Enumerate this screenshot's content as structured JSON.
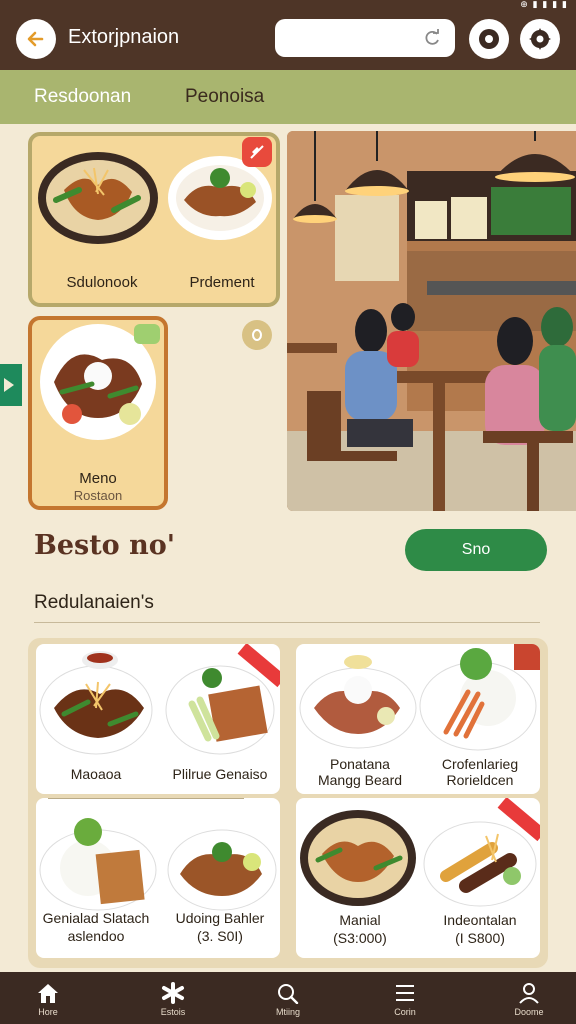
{
  "status_bar": {
    "icons": "⊕ ▮ ▮ ▮ ▮"
  },
  "header": {
    "title": "Extorjpnaion",
    "search": {
      "value": "",
      "placeholder": ""
    }
  },
  "subnav": {
    "tabs": [
      "Resdoonan",
      "Peonoisa"
    ]
  },
  "featured": {
    "card1": {
      "dishes": [
        "Sdulonook",
        "Prdement"
      ]
    },
    "card2": {
      "name": "Meno",
      "price": "Rostaon"
    }
  },
  "section": {
    "title": "Besto no'",
    "button": "Sno",
    "subheading": "Redulanaien's"
  },
  "menu_items": [
    {
      "name": "Maoaoa",
      "sub": ""
    },
    {
      "name": "Plilrue Genaiso",
      "sub": ""
    },
    {
      "name": "Ponatana",
      "sub": "Mangg Beard"
    },
    {
      "name": "Crofenlarieg",
      "sub": "Rorieldcen"
    },
    {
      "name": "Genialad Slatach",
      "sub": "aslendoo"
    },
    {
      "name": "Udoing Bahler",
      "sub": "(3. S0I)"
    },
    {
      "name": "Manial",
      "sub": "(S3:000)"
    },
    {
      "name": "Indeontalan",
      "sub": "(I S800)"
    }
  ],
  "bottom_nav": [
    {
      "label": "Hore",
      "icon": "home-icon"
    },
    {
      "label": "Estois",
      "icon": "asterisk-icon"
    },
    {
      "label": "Mtiing",
      "icon": "search-icon"
    },
    {
      "label": "Corin",
      "icon": "list-icon"
    },
    {
      "label": "Doome",
      "icon": "person-icon"
    }
  ],
  "colors": {
    "header": "#4e3527",
    "subnav": "#a9b56f",
    "accent_green": "#2e8b47",
    "background": "#f3ead5",
    "nav_bar": "#3b2a22"
  }
}
